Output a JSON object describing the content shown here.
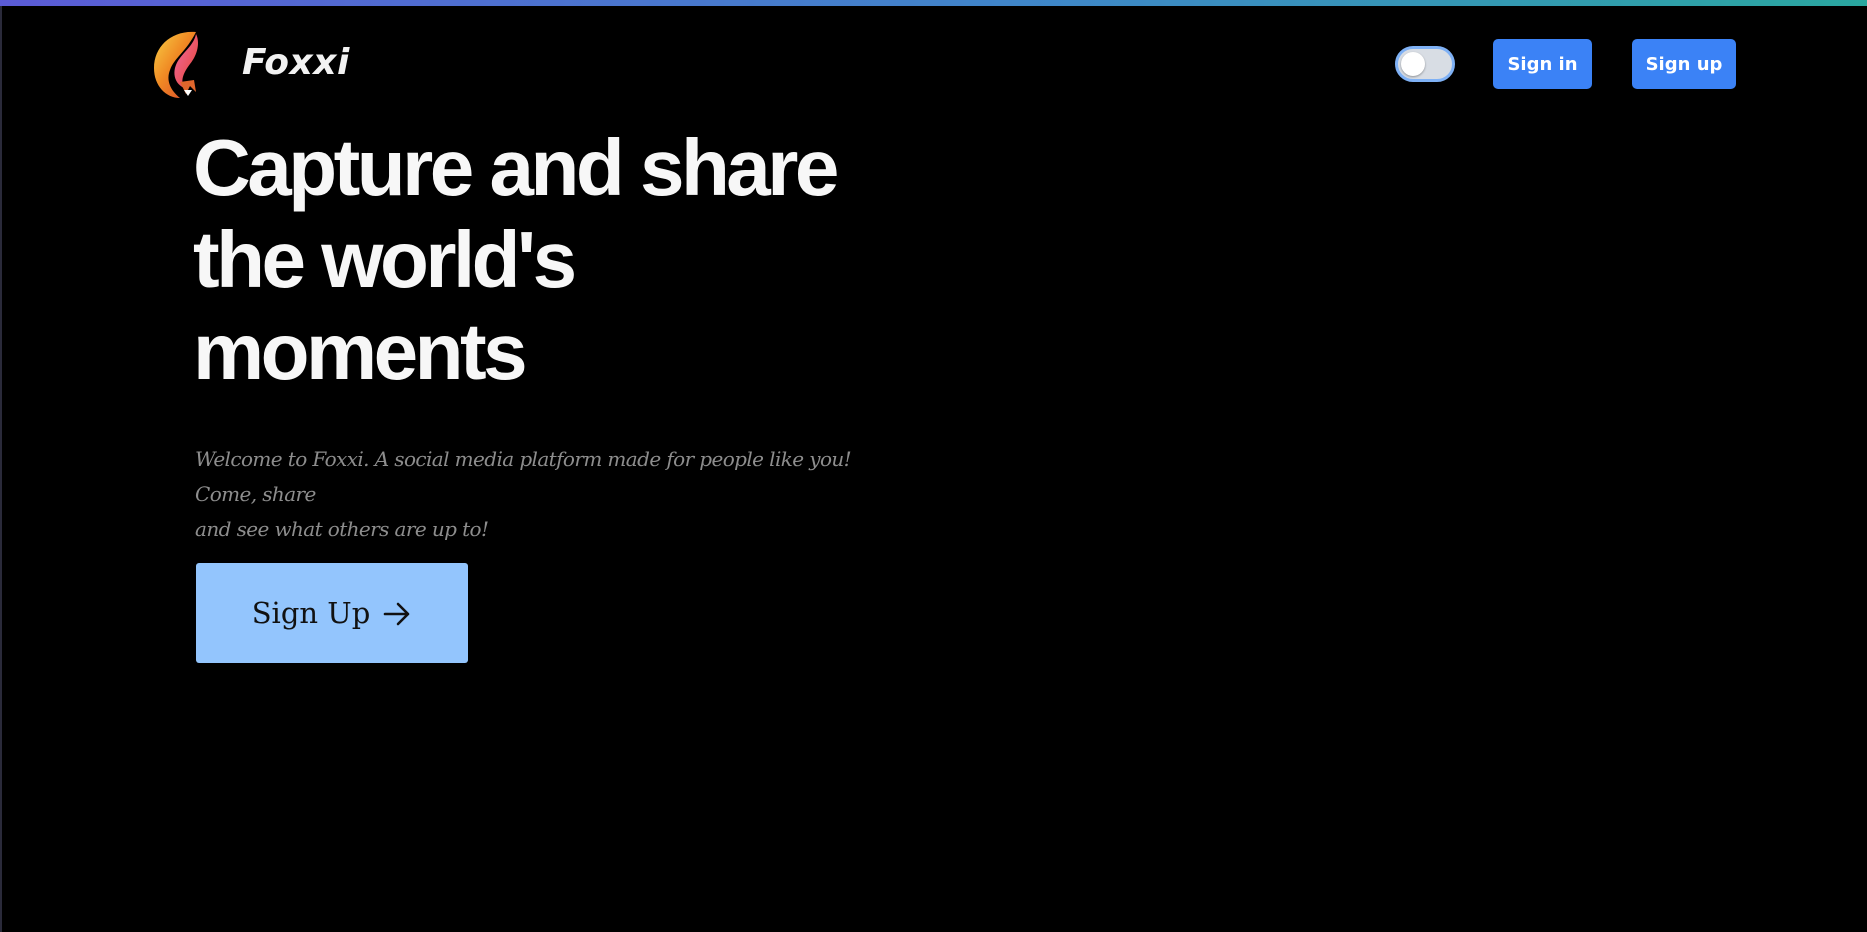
{
  "app": {
    "brand_name": "Foxxi",
    "logo_icon": "fox-logo-icon"
  },
  "header": {
    "theme_toggle": {
      "icon": "toggle-switch",
      "state": "off"
    },
    "sign_in_label": "Sign in",
    "sign_up_label": "Sign up"
  },
  "hero": {
    "headline_lines": [
      "Capture and share",
      "the world's",
      "moments"
    ],
    "subtext_lines": [
      "Welcome to Foxxi. A social media platform made for people like you! Come, share",
      "and see what others are up to!"
    ],
    "cta_label": "Sign Up",
    "cta_icon": "arrow-right-icon"
  },
  "colors": {
    "background": "#000000",
    "button_primary": "#3b82f6",
    "cta_background": "#93c5fd",
    "headline": "#f7f7f7",
    "subtext": "#8d8d8d",
    "top_gradient_start": "#5b5bd6",
    "top_gradient_end": "#2aa7a0"
  }
}
